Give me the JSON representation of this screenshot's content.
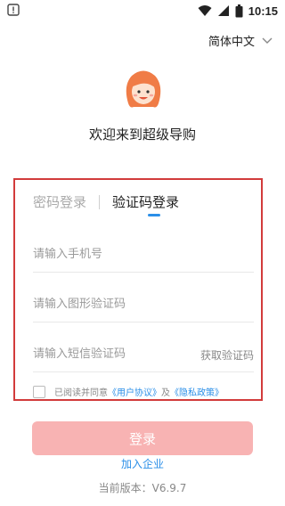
{
  "status_bar": {
    "time": "10:15",
    "left_icon": "alert-icon",
    "icons": [
      "wifi-icon",
      "signal-icon",
      "battery-icon"
    ]
  },
  "header": {
    "language_label": "简体中文",
    "language_icon": "chevron-down-icon"
  },
  "brand": {
    "logo_icon": "girl-avatar-logo",
    "welcome_text": "欢迎来到超级导购"
  },
  "login": {
    "tabs": [
      {
        "label": "密码登录",
        "active": false
      },
      {
        "label": "验证码登录",
        "active": true
      }
    ],
    "phone_placeholder": "请输入手机号",
    "image_captcha_placeholder": "请输入图形验证码",
    "sms_code_placeholder": "请输入短信验证码",
    "get_code_label": "获取验证码",
    "agreement": {
      "prefix": "已阅读并同意",
      "user_agreement": "《用户协议》",
      "and": "及",
      "privacy_policy": "《隐私政策》"
    },
    "submit_label": "登录"
  },
  "footer": {
    "join_label": "加入企业",
    "version_label": "当前版本：V6.9.7"
  },
  "colors": {
    "accent": "#2b8fe8",
    "highlight_border": "#d23b3b",
    "button_disabled": "#f8b3b3"
  }
}
